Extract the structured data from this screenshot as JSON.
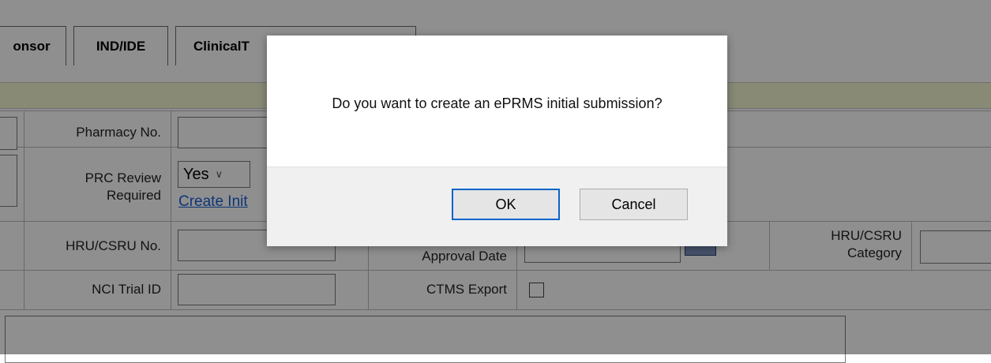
{
  "tabs": [
    {
      "label": "onsor"
    },
    {
      "label": "IND/IDE"
    },
    {
      "label": "ClinicalT"
    }
  ],
  "form": {
    "pharmacy_label": "Pharmacy No.",
    "prc_label": "PRC Review Required",
    "prc_value": "Yes",
    "create_link": "Create Init",
    "hru_label": "HRU/CSRU No.",
    "approval_label": "Approval Date",
    "hru_category_label": "HRU/CSRU Category",
    "nci_label": "NCI Trial ID",
    "ctms_label": "CTMS Export"
  },
  "dialog": {
    "message": "Do you want to create an ePRMS initial submission?",
    "ok_label": "OK",
    "cancel_label": "Cancel"
  }
}
